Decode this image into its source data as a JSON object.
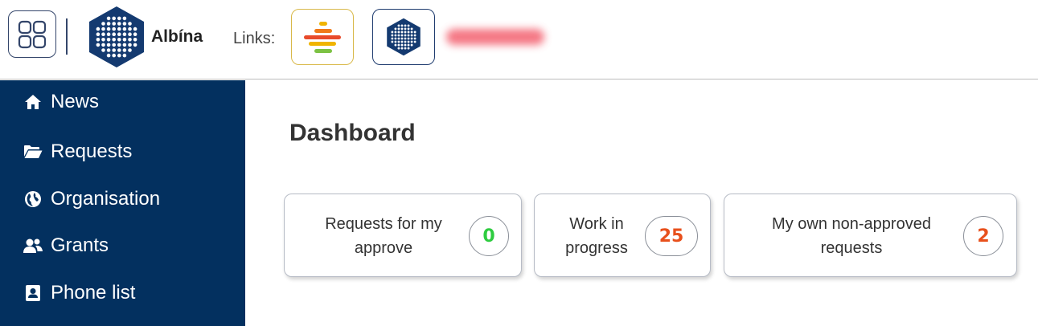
{
  "header": {
    "apps_icon": "grid-apps-icon",
    "brand": "Albína",
    "links_label": "Links:",
    "links": [
      {
        "icon": "striped-bars-icon",
        "accent": "#d9b94a"
      },
      {
        "icon": "hexagon-dots-icon",
        "accent": "#1e3b6e"
      }
    ]
  },
  "sidebar": {
    "background": "#03305f",
    "items": [
      {
        "label": "News",
        "icon": "home-icon"
      },
      {
        "label": "Requests",
        "icon": "folder-open-icon"
      },
      {
        "label": "Organisation",
        "icon": "globe-icon"
      },
      {
        "label": "Grants",
        "icon": "users-icon"
      },
      {
        "label": "Phone list",
        "icon": "contact-card-icon"
      }
    ]
  },
  "main": {
    "title": "Dashboard",
    "cards": [
      {
        "label": "Requests for my approve",
        "count": "0",
        "count_color": "#2ecc40"
      },
      {
        "label": "Work in progress",
        "count": "25",
        "count_color": "#e8501c"
      },
      {
        "label": "My own non-approved requests",
        "count": "2",
        "count_color": "#e8501c"
      }
    ]
  }
}
